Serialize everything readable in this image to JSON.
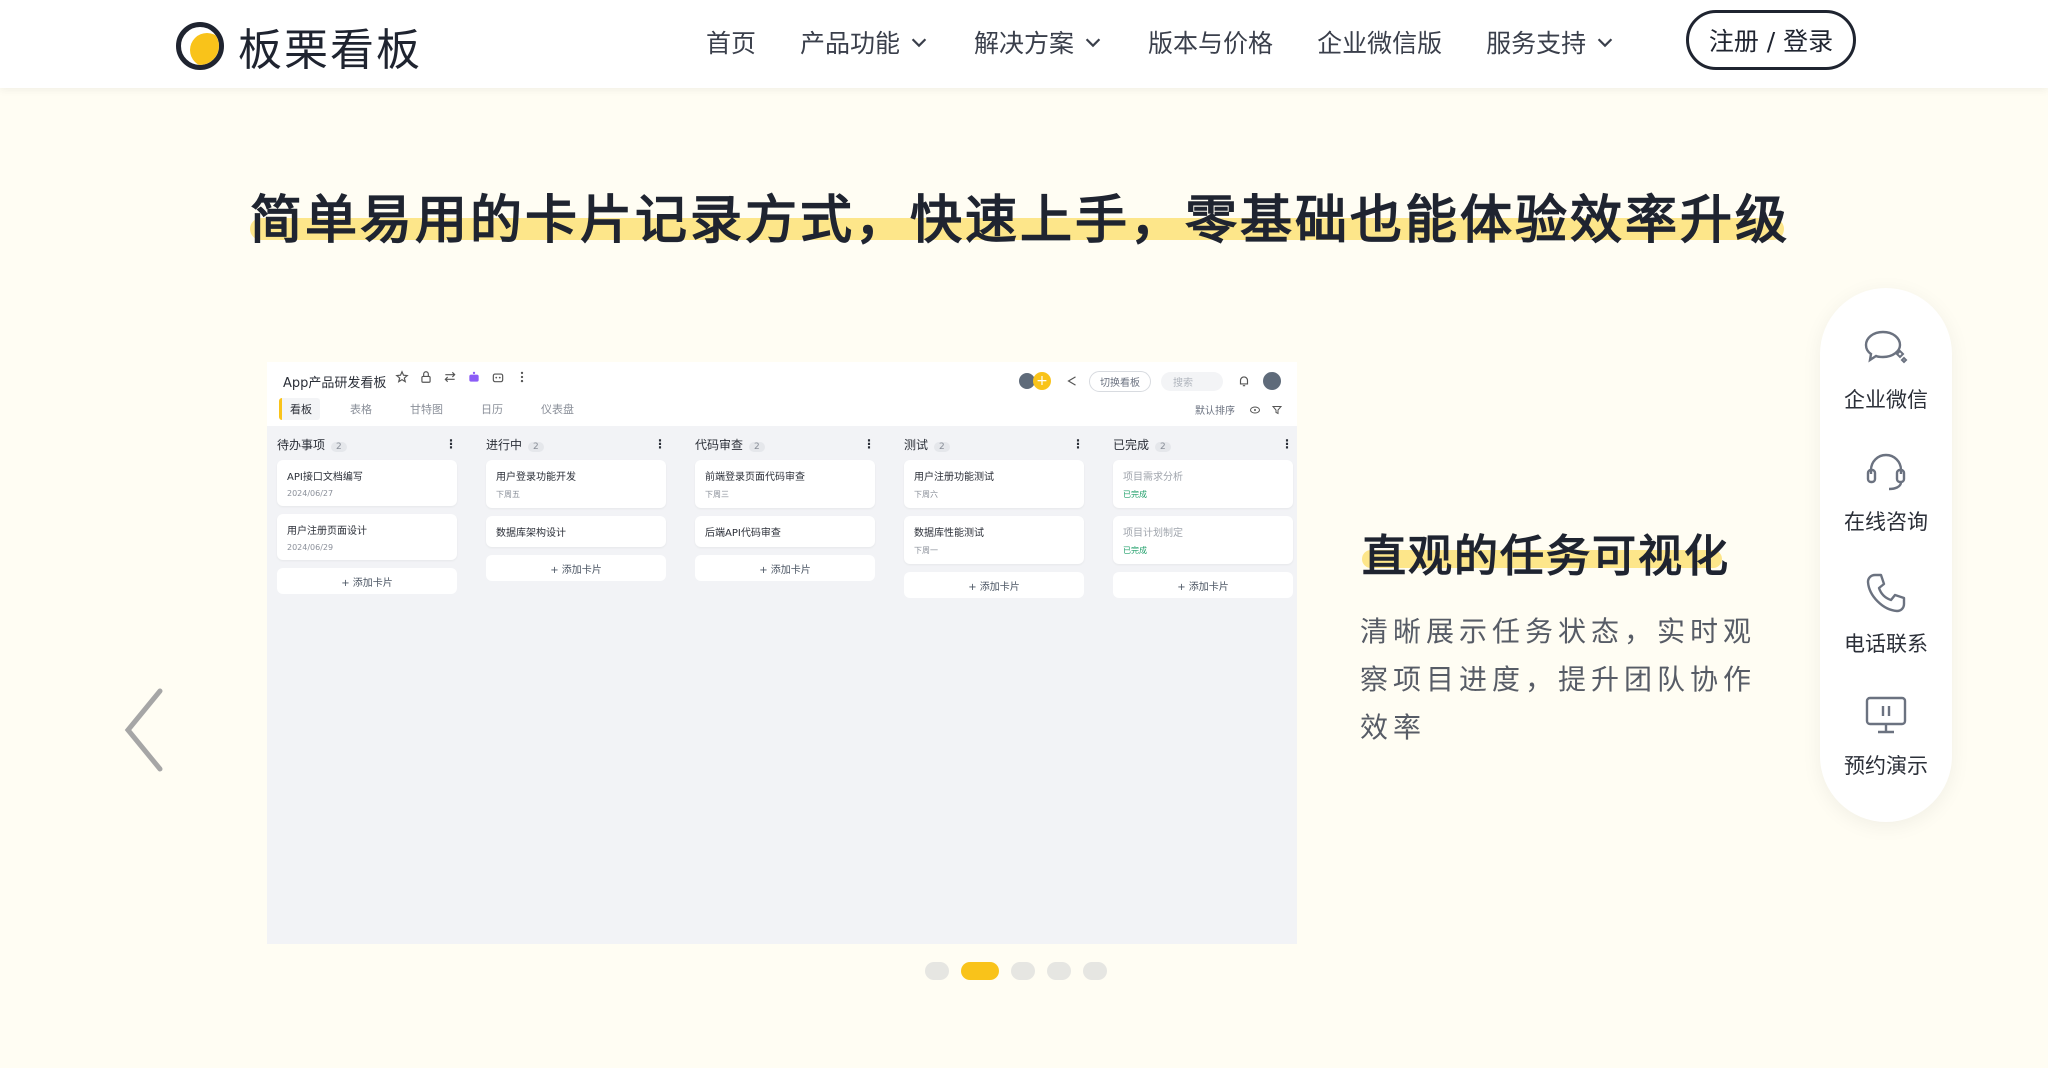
{
  "brand": {
    "name": "板栗看板"
  },
  "nav": {
    "items": [
      {
        "label": "首页",
        "dropdown": false
      },
      {
        "label": "产品功能",
        "dropdown": true
      },
      {
        "label": "解决方案",
        "dropdown": true
      },
      {
        "label": "版本与价格",
        "dropdown": false
      },
      {
        "label": "企业微信版",
        "dropdown": false
      },
      {
        "label": "服务支持",
        "dropdown": true
      }
    ],
    "login_label": "注册 / 登录"
  },
  "hero": {
    "title": "简单易用的卡片记录方式，快速上手，零基础也能体验效率升级"
  },
  "slide": {
    "heading": "直观的任务可视化",
    "description": "清晰展示任务状态，实时观察项目进度，提升团队协作效率",
    "active_index": 1,
    "total": 5
  },
  "kanban": {
    "board_title": "App产品研发看板",
    "switch_label": "切换看板",
    "search_placeholder": "搜索",
    "tabs": [
      "看板",
      "表格",
      "甘特图",
      "日历",
      "仪表盘"
    ],
    "sort_label": "默认排序",
    "add_card_label": "+ 添加卡片",
    "columns": [
      {
        "title": "待办事项",
        "count": "2",
        "cards": [
          {
            "title": "API接口文档编写",
            "meta": "2024/06/27",
            "done": false
          },
          {
            "title": "用户注册页面设计",
            "meta": "2024/06/29",
            "done": false
          }
        ]
      },
      {
        "title": "进行中",
        "count": "2",
        "cards": [
          {
            "title": "用户登录功能开发",
            "meta": "下周五",
            "done": false
          },
          {
            "title": "数据库架构设计",
            "meta": "",
            "done": false
          }
        ]
      },
      {
        "title": "代码审查",
        "count": "2",
        "cards": [
          {
            "title": "前端登录页面代码审查",
            "meta": "下周三",
            "done": false
          },
          {
            "title": "后端API代码审查",
            "meta": "",
            "done": false
          }
        ]
      },
      {
        "title": "测试",
        "count": "2",
        "cards": [
          {
            "title": "用户注册功能测试",
            "meta": "下周六",
            "done": false
          },
          {
            "title": "数据库性能测试",
            "meta": "下周一",
            "done": false
          }
        ]
      },
      {
        "title": "已完成",
        "count": "2",
        "cards": [
          {
            "title": "项目需求分析",
            "meta": "已完成",
            "done": true
          },
          {
            "title": "项目计划制定",
            "meta": "已完成",
            "done": true
          }
        ]
      }
    ]
  },
  "side_panel": {
    "items": [
      {
        "label": "企业微信",
        "icon": "chat-bubbles-icon"
      },
      {
        "label": "在线咨询",
        "icon": "headset-icon"
      },
      {
        "label": "电话联系",
        "icon": "phone-icon"
      },
      {
        "label": "预约演示",
        "icon": "monitor-icon"
      }
    ]
  },
  "colors": {
    "accent": "#f9c31a",
    "highlight": "#fde68a",
    "background": "#fffdf3",
    "text": "#1f2430"
  }
}
